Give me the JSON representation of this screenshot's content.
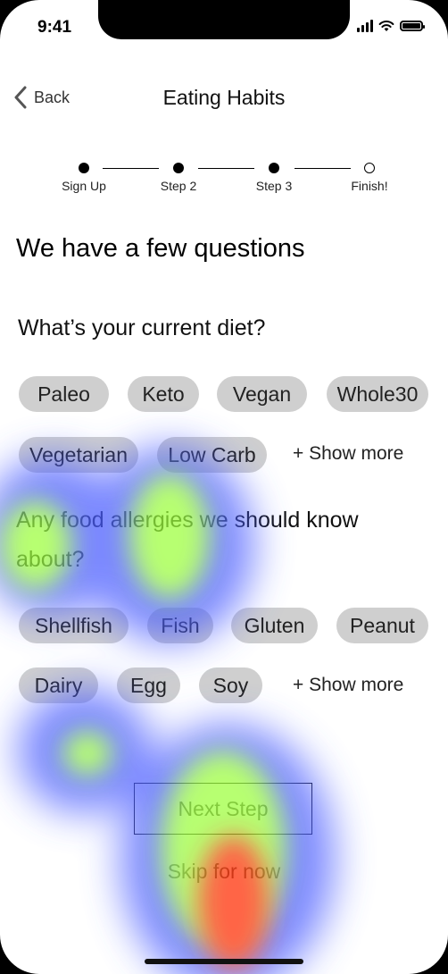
{
  "status_bar": {
    "time": "9:41"
  },
  "header": {
    "back_label": "Back",
    "title": "Eating Habits"
  },
  "stepper": {
    "steps": [
      {
        "label": "Sign Up",
        "completed": true
      },
      {
        "label": "Step 2",
        "completed": true
      },
      {
        "label": "Step 3",
        "completed": true
      },
      {
        "label": "Finish!",
        "completed": false
      }
    ]
  },
  "section_title": "We have a few questions",
  "diet": {
    "question": "What’s your current diet?",
    "options": [
      "Paleo",
      "Keto",
      "Vegan",
      "Whole30",
      "Vegetarian",
      "Low Carb"
    ],
    "show_more": "+ Show more"
  },
  "allergies": {
    "question": "Any food allergies we should know about?",
    "options": [
      "Shellfish",
      "Fish",
      "Gluten",
      "Peanut",
      "Dairy",
      "Egg",
      "Soy"
    ],
    "show_more": "+ Show more"
  },
  "actions": {
    "next_label": "Next Step",
    "skip_label": "Skip for now"
  },
  "heatmap": {
    "colors": {
      "low": "#4a5cff",
      "mid": "#9cff3a",
      "high": "#ff2a00"
    }
  }
}
